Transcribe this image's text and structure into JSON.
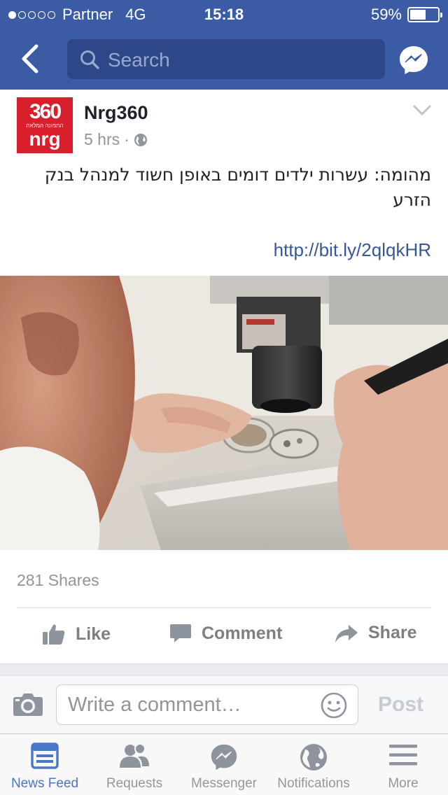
{
  "status_bar": {
    "carrier": "Partner",
    "network": "4G",
    "time": "15:18",
    "battery": "59%",
    "battery_level": 0.59,
    "signal_bars": 1
  },
  "nav": {
    "search_placeholder": "Search",
    "back_icon": "chevron-left-icon",
    "messenger_icon": "messenger-icon"
  },
  "post": {
    "author": "Nrg360",
    "logo_text_top": "360",
    "logo_text_small": "התמונה המלאה",
    "logo_text_bottom": "nrg",
    "time": "5 hrs",
    "privacy_icon": "globe-icon",
    "text": "מהומה: עשרות ילדים דומים באופן חשוד למנהל בנק הזרע",
    "link": "http://bit.ly/2qlqkHR",
    "shares": "281 Shares"
  },
  "actions": {
    "like": "Like",
    "comment": "Comment",
    "share": "Share"
  },
  "comment_bar": {
    "placeholder": "Write a comment…",
    "post_label": "Post"
  },
  "tabs": [
    {
      "label": "News Feed",
      "icon": "news-feed-icon",
      "active": true
    },
    {
      "label": "Requests",
      "icon": "requests-icon",
      "active": false
    },
    {
      "label": "Messenger",
      "icon": "messenger-icon",
      "active": false
    },
    {
      "label": "Notifications",
      "icon": "globe-icon",
      "active": false
    },
    {
      "label": "More",
      "icon": "menu-icon",
      "active": false
    }
  ],
  "colors": {
    "header_blue": "#3b5ba5",
    "link_blue": "#365899",
    "tab_active": "#4a76c7",
    "logo_red": "#d8202c"
  }
}
